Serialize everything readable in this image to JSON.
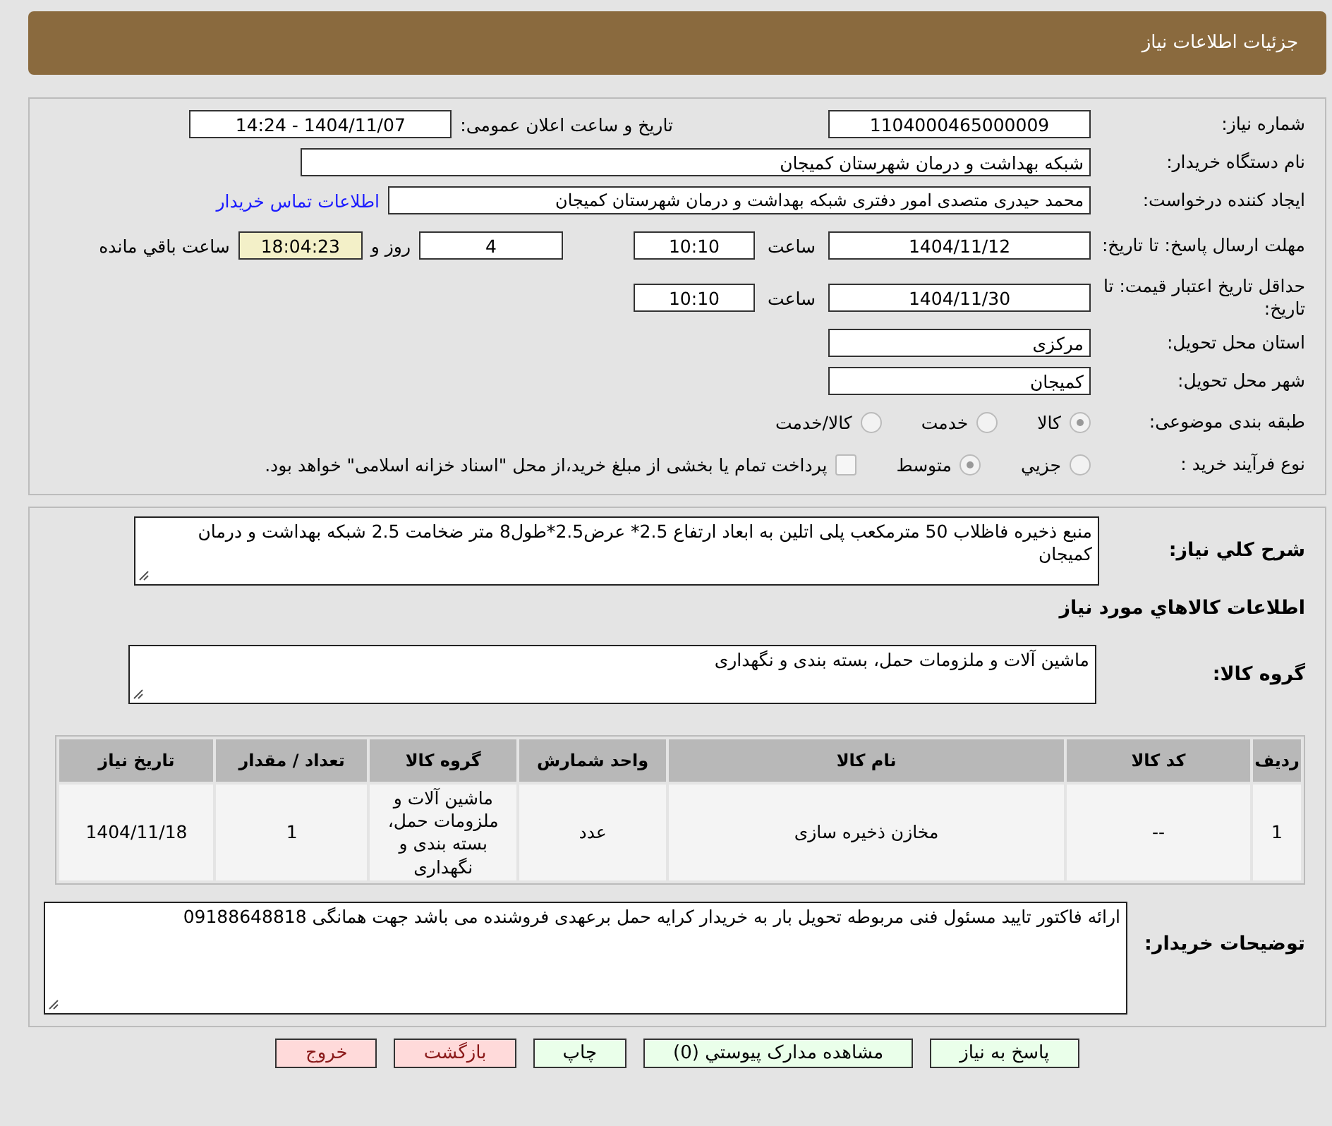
{
  "header": {
    "title": "جزئیات اطلاعات نیاز"
  },
  "need_number": {
    "label": "شماره نیاز:",
    "value": "1104000465000009"
  },
  "announce_date": {
    "label": "تاریخ و ساعت اعلان عمومی:",
    "value": "1404/11/07 - 14:24"
  },
  "buyer_org": {
    "label": "نام دستگاه خریدار:",
    "value": "شبکه بهداشت و درمان شهرستان کمیجان"
  },
  "requester": {
    "label": "ایجاد کننده درخواست:",
    "value": "محمد حیدری متصدی امور دفتری شبکه بهداشت و درمان شهرستان کمیجان",
    "link": "اطلاعات تماس خریدار"
  },
  "reply_deadline": {
    "label": "مهلت ارسال پاسخ: تا تاریخ:",
    "date": "1404/11/12",
    "time_label": "ساعت",
    "time": "10:10",
    "days": "4",
    "days_label": "روز و",
    "remaining": "18:04:23",
    "remaining_label": "ساعت باقي مانده"
  },
  "price_validity": {
    "label": "حداقل تاریخ اعتبار قیمت: تا تاریخ:",
    "date": "1404/11/30",
    "time_label": "ساعت",
    "time": "10:10"
  },
  "province": {
    "label": "استان محل تحویل:",
    "value": "مرکزی"
  },
  "city": {
    "label": "شهر محل تحویل:",
    "value": "کمیجان"
  },
  "category": {
    "label": "طبقه بندی موضوعی:",
    "options": [
      {
        "label": "کالا",
        "selected": true
      },
      {
        "label": "خدمت",
        "selected": false
      },
      {
        "label": "کالا/خدمت",
        "selected": false
      }
    ]
  },
  "process": {
    "label": "نوع فرآیند خرید :",
    "options": [
      {
        "label": "جزيي",
        "selected": false
      },
      {
        "label": "متوسط",
        "selected": true
      }
    ],
    "treasury": {
      "checked": false,
      "label": "پرداخت تمام یا بخشی از مبلغ خرید،از محل \"اسناد خزانه اسلامی\" خواهد بود."
    }
  },
  "description": {
    "label": "شرح کلي نیاز:",
    "value": "منبع ذخیره فاظلاب 50 مترمکعب پلی اتلین به ابعاد ارتفاع 2.5* عرض2.5*طول8 متر ضخامت 2.5 شبکه بهداشت و درمان کمیجان"
  },
  "goods_heading": "اطلاعات کالاهاي مورد نیاز",
  "goods_group": {
    "label": "گروه کالا:",
    "value": "ماشین آلات و ملزومات حمل، بسته بندی و نگهداری"
  },
  "table": {
    "columns": [
      "ردیف",
      "کد کالا",
      "نام کالا",
      "واحد شمارش",
      "گروه کالا",
      "تعداد / مقدار",
      "تاریخ نیاز"
    ],
    "rows": [
      [
        "1",
        "--",
        "مخازن ذخیره سازی",
        "عدد",
        "ماشین آلات و ملزومات حمل، بسته بندی و نگهداری",
        "1",
        "1404/11/18"
      ]
    ]
  },
  "buyer_notes": {
    "label": "توضیحات خریدار:",
    "value": "ارائه فاکتور تایید مسئول فنی مربوطه تحویل بار به  خریدار کرایه حمل برعهدی فروشنده می باشد جهت همانگی 09188648818"
  },
  "buttons": [
    {
      "label": "پاسخ به نیاز",
      "kind": "primary"
    },
    {
      "label": "مشاهده مدارک پیوستي (0)",
      "kind": "primary"
    },
    {
      "label": "چاپ",
      "kind": "primary"
    },
    {
      "label": "بازگشت",
      "kind": "danger"
    },
    {
      "label": "خروج",
      "kind": "danger"
    }
  ]
}
